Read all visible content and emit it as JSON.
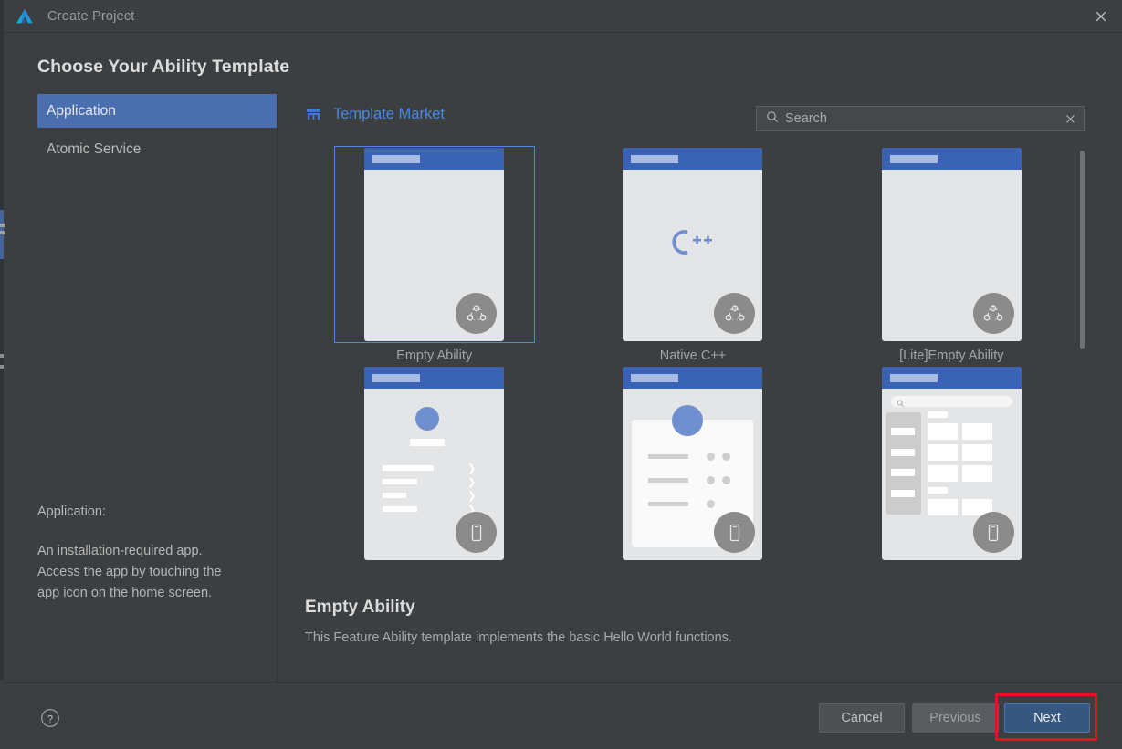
{
  "window": {
    "title": "Create Project",
    "logo_icon": "deveco-logo-icon",
    "close_icon": "close-icon"
  },
  "page_title": "Choose Your Ability Template",
  "left_pane": {
    "categories": [
      {
        "label": "Application",
        "selected": true
      },
      {
        "label": "Atomic Service",
        "selected": false
      }
    ],
    "description_label": "Application:",
    "description_lines": [
      "An installation-required app.",
      "Access the app by touching the",
      "app icon on the home screen."
    ]
  },
  "right_pane": {
    "market": {
      "label": "Template Market",
      "icon": "store-icon"
    },
    "search": {
      "placeholder": "Search",
      "value": "",
      "icon": "search-icon",
      "clear_icon": "close-icon"
    },
    "templates": [
      {
        "caption": "Empty Ability",
        "selected": true,
        "mock": "blank",
        "badge": "distributed-icon"
      },
      {
        "caption": "Native C++",
        "selected": false,
        "mock": "cpp",
        "badge": "distributed-icon",
        "mark": "C++"
      },
      {
        "caption": "[Lite]Empty Ability",
        "selected": false,
        "mock": "blank",
        "badge": "distributed-icon"
      },
      {
        "caption": "",
        "selected": false,
        "mock": "list",
        "badge": "phone-icon"
      },
      {
        "caption": "",
        "selected": false,
        "mock": "card",
        "badge": "phone-icon"
      },
      {
        "caption": "",
        "selected": false,
        "mock": "catalog",
        "badge": "phone-icon"
      }
    ],
    "detail": {
      "title": "Empty Ability",
      "description": "This Feature Ability template implements the basic Hello World functions."
    },
    "scrollbar": {
      "name": "template-grid-scrollbar"
    }
  },
  "footer": {
    "help_icon": "help-icon",
    "buttons": [
      {
        "label": "Cancel",
        "kind": "secondary"
      },
      {
        "label": "Previous",
        "kind": "disabled"
      },
      {
        "label": "Next",
        "kind": "primary",
        "highlighted": true
      }
    ]
  },
  "colors": {
    "background": "#3c3f41",
    "selection_blue": "#4b6eaf",
    "link_blue": "#4a88e0",
    "primary_button": "#365880",
    "annotation_red": "#e81123",
    "phone_topbar": "#3a63b4"
  }
}
